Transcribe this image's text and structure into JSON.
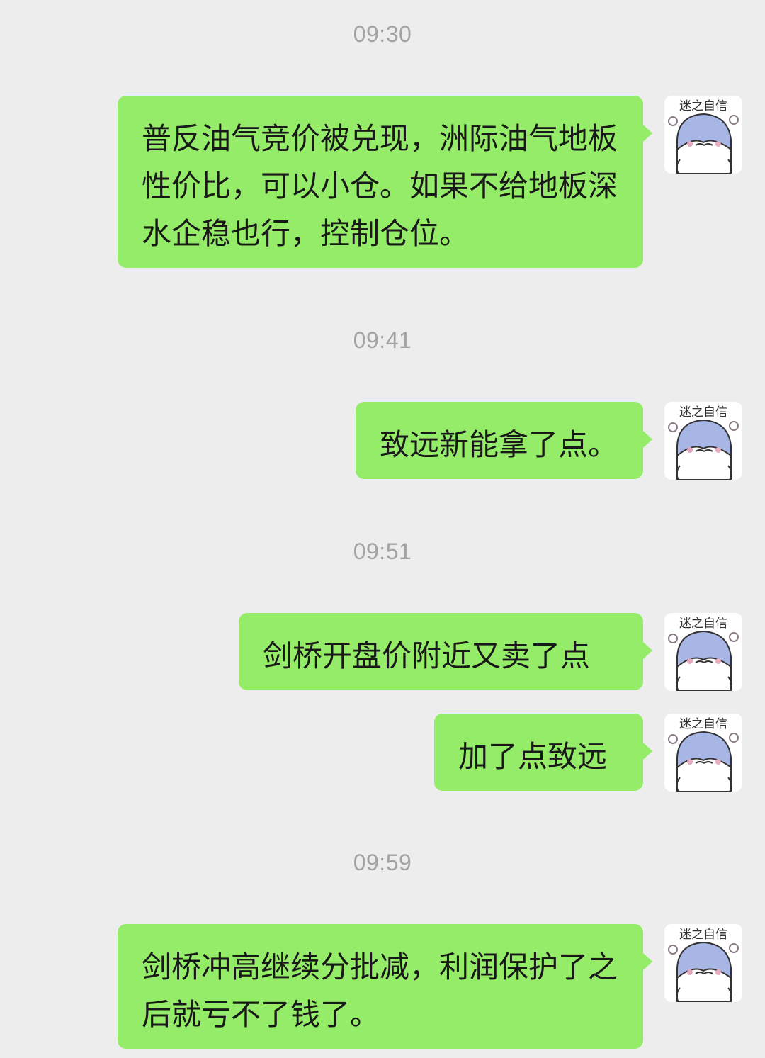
{
  "messages": [
    {
      "time": "09:30",
      "text": "普反油气竞价被兑现，洲际油气地板性价比，可以小仓。如果不给地板深水企稳也行，控制仓位。"
    },
    {
      "time": "09:41",
      "text": "致远新能拿了点。"
    },
    {
      "time": "09:51",
      "text": "剑桥开盘价附近又卖了点"
    },
    {
      "time": "",
      "text": "加了点致远"
    },
    {
      "time": "09:59",
      "text": "剑桥冲高继续分批减，利润保护了之后就亏不了钱了。"
    }
  ],
  "avatar": {
    "caption": "迷之自信",
    "icon": "blue-cartoon-character-avatar-icon"
  },
  "colors": {
    "background": "#ededed",
    "bubble": "#95ec69",
    "timestamp": "#a3a3a3",
    "text": "#191919"
  }
}
